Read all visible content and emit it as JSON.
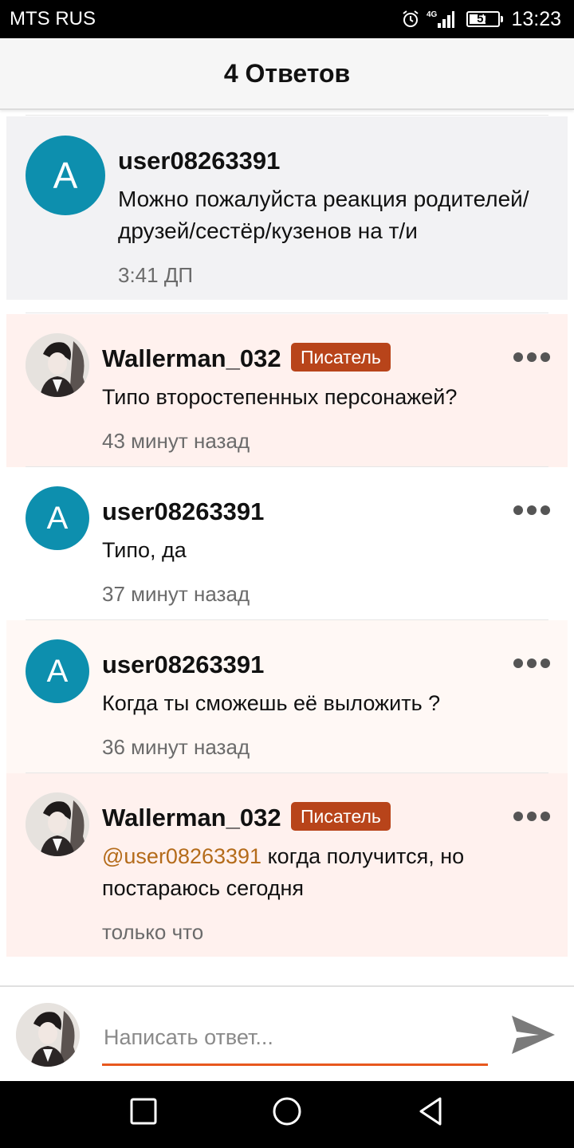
{
  "status_bar": {
    "carrier": "MTS RUS",
    "network": "4G",
    "battery": "57",
    "battery_level": 0.57,
    "time": "13:23"
  },
  "header": {
    "title": "4 Ответов"
  },
  "post": {
    "avatar_letter": "A",
    "username": "user08263391",
    "text_line1": "Можно пожалуйста реакция  родителей/",
    "text_line2": "друзей/сестёр/кузенов на т/и",
    "time": "3:41 ДП"
  },
  "replies": [
    {
      "username": "Wallerman_032",
      "badge": "Писатель",
      "text": "Типо второстепенных персонажей?",
      "time": "43 минут назад"
    },
    {
      "avatar_letter": "A",
      "username": "user08263391",
      "text": "Типо, да",
      "time": "37 минут назад"
    },
    {
      "avatar_letter": "A",
      "username": "user08263391",
      "text": "Когда ты сможешь её выложить ?",
      "time": "36 минут назад"
    },
    {
      "username": "Wallerman_032",
      "badge": "Писатель",
      "mention": "@user08263391",
      "text_line1": " когда получится, но",
      "text_line2": "постараюсь сегодня",
      "time": "только что"
    }
  ],
  "reply_input": {
    "placeholder": "Написать ответ..."
  },
  "colors": {
    "accent": "#e8581e",
    "badge": "#b8441a",
    "avatar": "#0d8fae",
    "mention": "#b46b1a"
  },
  "icons": [
    "alarm-icon",
    "signal-icon",
    "battery-icon",
    "more-icon",
    "send-icon",
    "nav-back-icon",
    "nav-home-icon",
    "nav-recent-icon"
  ]
}
